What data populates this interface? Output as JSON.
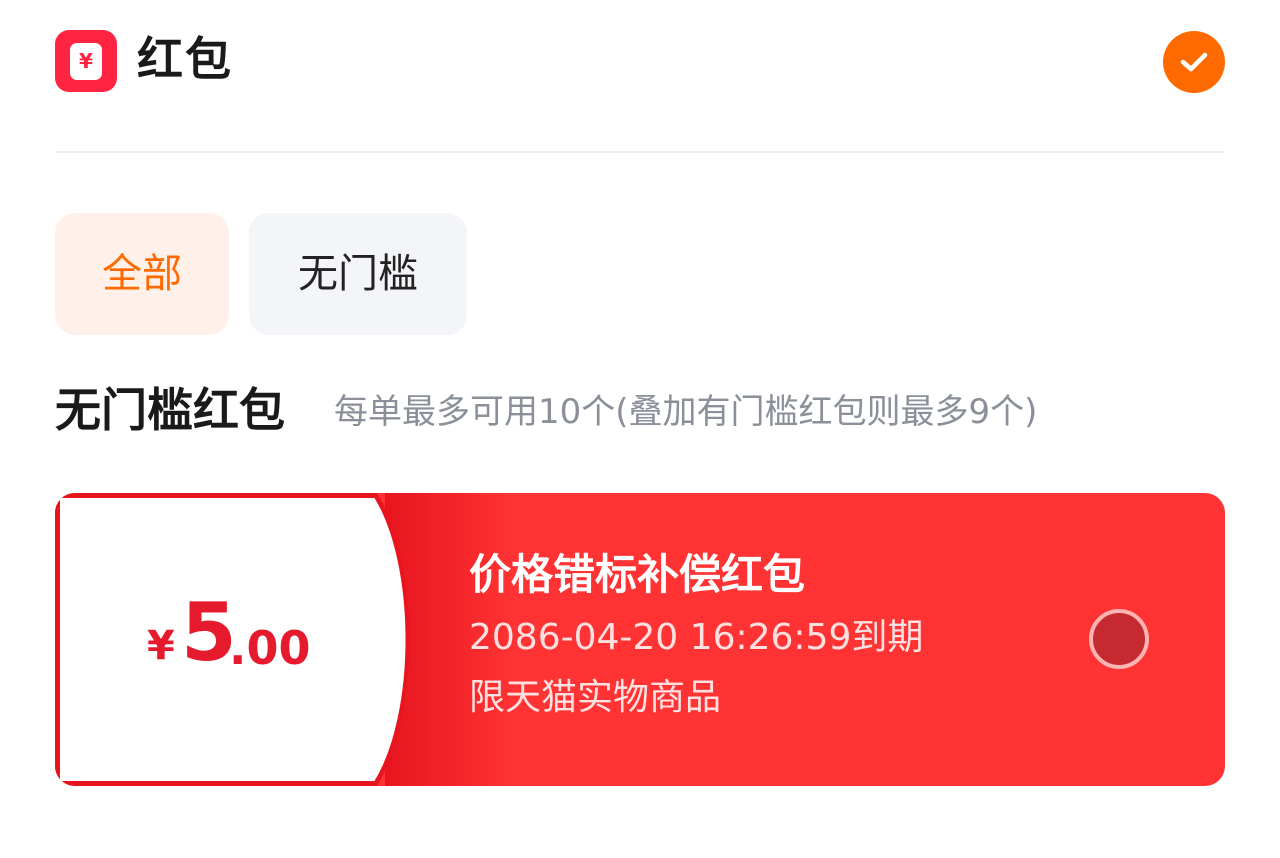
{
  "header": {
    "app_icon_glyph": "¥",
    "title": "红包",
    "confirm_icon": "check-icon"
  },
  "filters": [
    {
      "label": "全部",
      "selected": true
    },
    {
      "label": "无门槛",
      "selected": false
    }
  ],
  "section": {
    "title": "无门槛红包",
    "hint": "每单最多可用10个(叠加有门槛红包则最多9个)"
  },
  "coupons": [
    {
      "currency": "¥",
      "amount_int": "5",
      "amount_dec": ".00",
      "name": "价格错标补偿红包",
      "expiry": "2086-04-20 16:26:59到期",
      "scope": "限天猫实物商品",
      "selected": false
    }
  ],
  "colors": {
    "brand_red": "#ff2442",
    "accent_orange": "#ff6a00",
    "coupon_red": "#ff3333",
    "amount_red": "#e61a2d"
  }
}
